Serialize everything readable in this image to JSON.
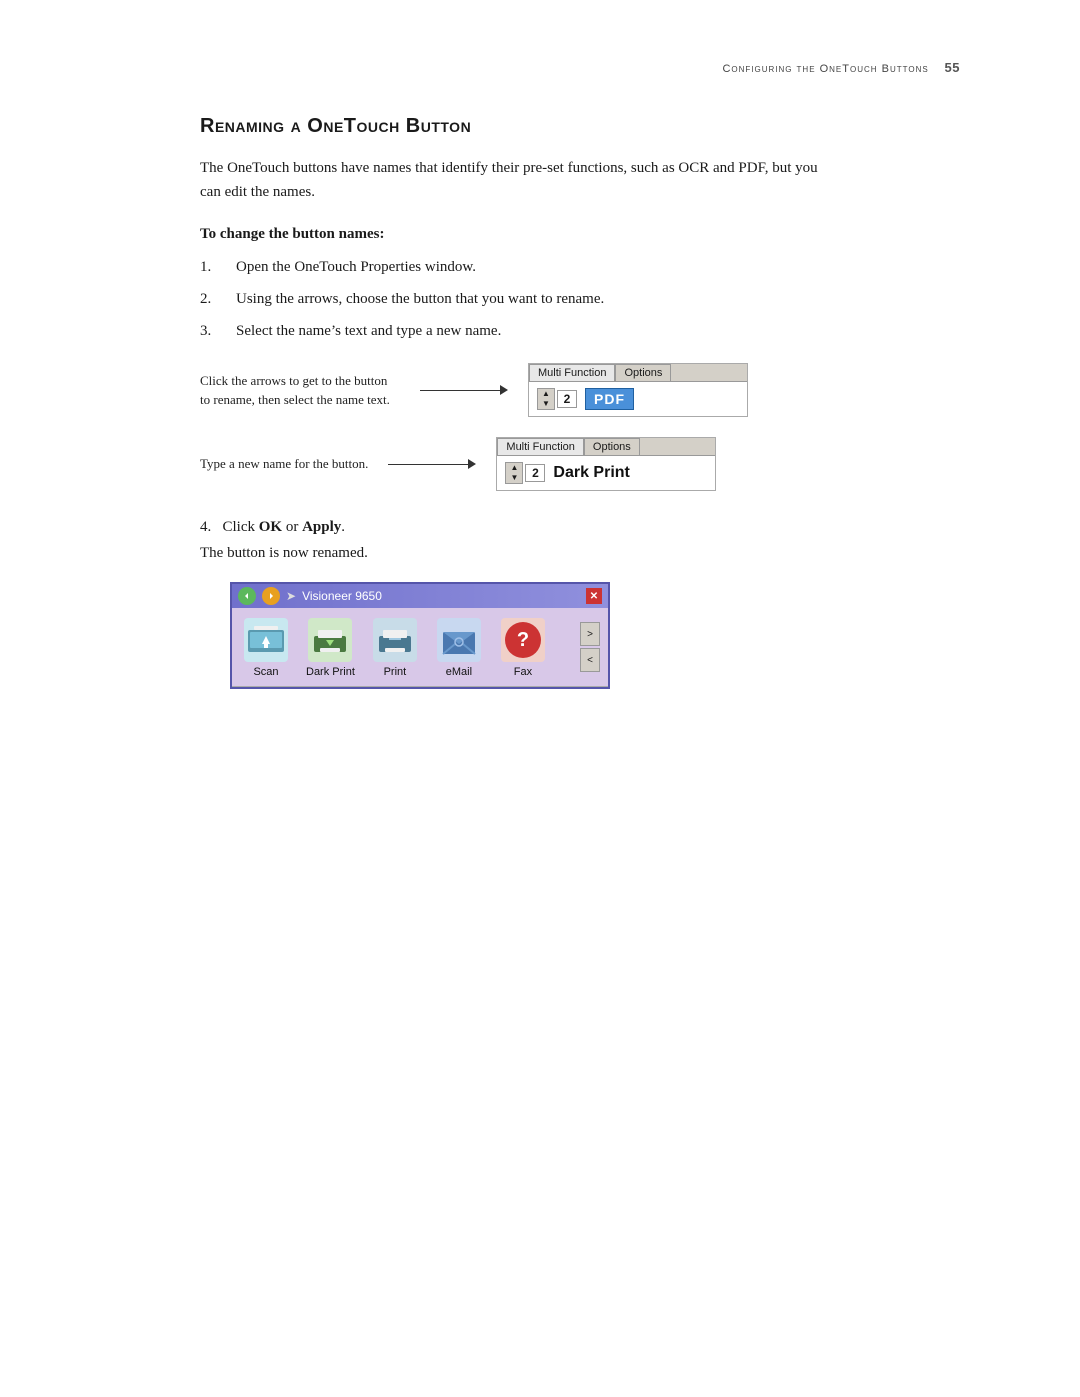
{
  "header": {
    "chapter": "Configuring the OneTouch Buttons",
    "page_number": "55"
  },
  "section": {
    "title": "Renaming a OneTouch Button",
    "intro": "The OneTouch buttons have names that identify their pre-set functions, such as OCR and PDF, but you can edit the names.",
    "subsection_title": "To change the button names:",
    "steps": [
      {
        "num": "1.",
        "text": "Open the OneTouch Properties window."
      },
      {
        "num": "2.",
        "text": "Using the arrows, choose the button that you want to rename."
      },
      {
        "num": "3.",
        "text": "Select the name’s text and type a new name."
      }
    ],
    "illustration": {
      "top_caption": "Click the arrows to get to the button to rename, then select the name text.",
      "bottom_caption": "Type a new name for the button.",
      "top_tab1": "Multi Function",
      "top_tab2": "Options",
      "top_num": "2",
      "top_name": "PDF",
      "bottom_tab1": "Multi Function",
      "bottom_tab2": "Options",
      "bottom_num": "2",
      "bottom_name": "Dark Print"
    },
    "step4": {
      "num": "4.",
      "text": "Click ",
      "ok_label": "OK",
      "or_text": " or ",
      "apply_label": "Apply",
      "period": "."
    },
    "renamed_text": "The button is now renamed.",
    "visioneer_window": {
      "title": "Visioneer 9650",
      "buttons": [
        {
          "label": "Scan"
        },
        {
          "label": "Dark Print"
        },
        {
          "label": "Print"
        },
        {
          "label": "eMail"
        },
        {
          "label": "Fax"
        }
      ],
      "nav_next": ">",
      "nav_prev": "<"
    }
  }
}
